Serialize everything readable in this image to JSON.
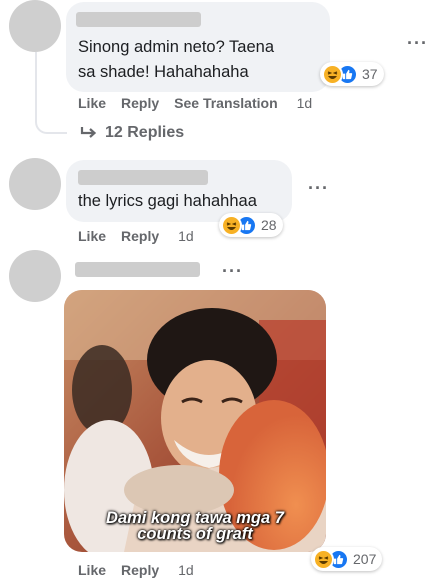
{
  "comments": [
    {
      "text_lines": [
        "Sinong admin neto? Taena",
        "sa shade! Hahahahaha"
      ],
      "reaction_count": "37",
      "actions": {
        "like": "Like",
        "reply": "Reply",
        "translate": "See Translation",
        "age": "1d"
      },
      "replies_label": "12 Replies",
      "more_icon": "more-dots-icon"
    },
    {
      "text_lines": [
        "the lyrics gagi hahahhaa"
      ],
      "reaction_count": "28",
      "actions": {
        "like": "Like",
        "reply": "Reply",
        "age": "1d"
      }
    },
    {
      "image_caption_lines": [
        "Dami kong tawa mga 7",
        "counts of graft"
      ],
      "reaction_count": "207",
      "actions": {
        "like": "Like",
        "reply": "Reply",
        "age": "1d"
      }
    }
  ],
  "icons": {
    "reaction_haha": "haha-reaction-icon",
    "reaction_like": "like-reaction-icon",
    "reply_arrow": "reply-arrow-icon"
  },
  "colors": {
    "bubble": "#f0f2f5",
    "muted_text": "#65676b",
    "like_blue": "#1877f2",
    "haha_yellow": "#f7b125"
  }
}
